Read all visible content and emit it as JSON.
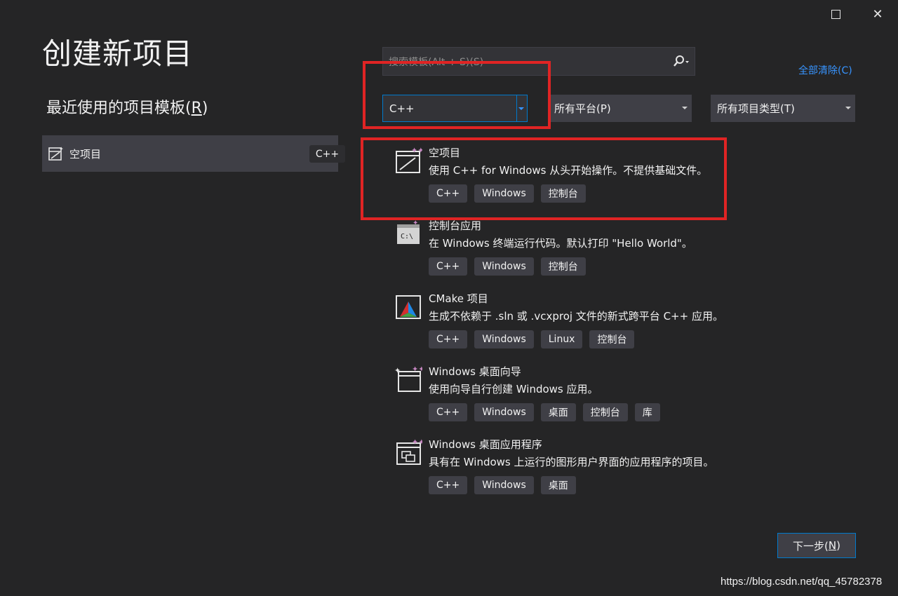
{
  "window": {
    "maximize_icon": "maximize-icon",
    "close_icon": "close-icon",
    "close_glyph": "✕"
  },
  "page_title": "创建新项目",
  "recent": {
    "title": "最近使用的项目模板(",
    "title_key": "R",
    "title_end": ")",
    "items": [
      {
        "label": "空项目",
        "tag": "C++",
        "icon": "empty-project-icon"
      }
    ]
  },
  "search": {
    "placeholder": "搜索模板(Alt + S)(S)",
    "icon": "search-icon"
  },
  "clear_all": "全部清除(C)",
  "filters": {
    "language": "C++",
    "platform": "所有平台(P)",
    "project_type": "所有项目类型(T)"
  },
  "templates": [
    {
      "name": "空项目",
      "desc": "使用 C++ for Windows 从头开始操作。不提供基础文件。",
      "tags": [
        "C++",
        "Windows",
        "控制台"
      ],
      "icon": "empty-project-icon"
    },
    {
      "name": "控制台应用",
      "desc": "在 Windows 终端运行代码。默认打印 \"Hello World\"。",
      "tags": [
        "C++",
        "Windows",
        "控制台"
      ],
      "icon": "console-app-icon"
    },
    {
      "name": "CMake 项目",
      "desc": "生成不依赖于 .sln 或 .vcxproj 文件的新式跨平台 C++ 应用。",
      "tags": [
        "C++",
        "Windows",
        "Linux",
        "控制台"
      ],
      "icon": "cmake-icon"
    },
    {
      "name": "Windows 桌面向导",
      "desc": "使用向导自行创建 Windows 应用。",
      "tags": [
        "C++",
        "Windows",
        "桌面",
        "控制台",
        "库"
      ],
      "icon": "desktop-wizard-icon"
    },
    {
      "name": "Windows 桌面应用程序",
      "desc": "具有在 Windows 上运行的图形用户界面的应用程序的项目。",
      "tags": [
        "C++",
        "Windows",
        "桌面"
      ],
      "icon": "desktop-app-icon"
    }
  ],
  "next_button": {
    "label": "下一步(",
    "key": "N",
    "end": ")"
  },
  "watermark": "https://blog.csdn.net/qq_45782378",
  "colors": {
    "background": "#252526",
    "accent": "#007acc",
    "link": "#3794ff",
    "highlight": "#e02424"
  }
}
